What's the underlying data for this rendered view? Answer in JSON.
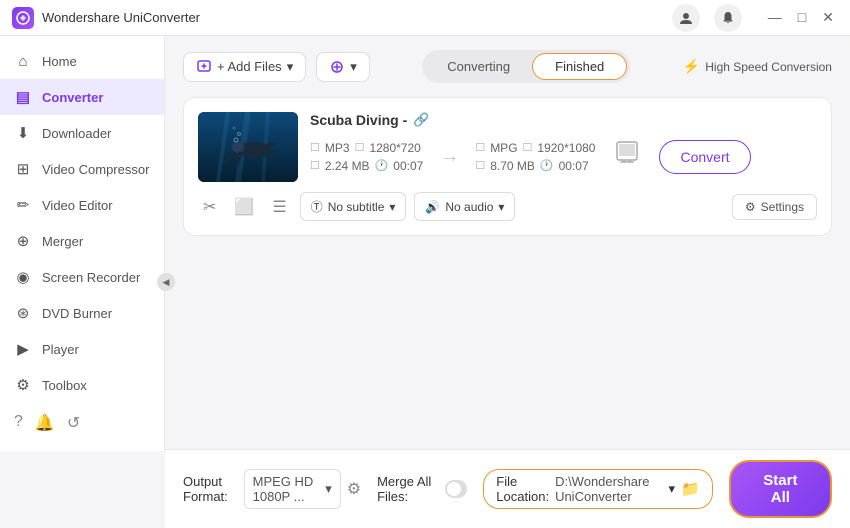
{
  "titleBar": {
    "appName": "Wondershare UniConverter",
    "logoText": "W",
    "userIcon": "👤",
    "bellIcon": "🔔",
    "minimizeIcon": "—",
    "maximizeIcon": "□",
    "closeIcon": "✕"
  },
  "sidebar": {
    "items": [
      {
        "id": "home",
        "label": "Home",
        "icon": "⌂",
        "active": false
      },
      {
        "id": "converter",
        "label": "Converter",
        "icon": "▤",
        "active": true
      },
      {
        "id": "downloader",
        "label": "Downloader",
        "icon": "⬇",
        "active": false
      },
      {
        "id": "video-compressor",
        "label": "Video Compressor",
        "icon": "⊞",
        "active": false
      },
      {
        "id": "video-editor",
        "label": "Video Editor",
        "icon": "✏",
        "active": false
      },
      {
        "id": "merger",
        "label": "Merger",
        "icon": "⊕",
        "active": false
      },
      {
        "id": "screen-recorder",
        "label": "Screen Recorder",
        "icon": "◉",
        "active": false
      },
      {
        "id": "dvd-burner",
        "label": "DVD Burner",
        "icon": "⊛",
        "active": false
      },
      {
        "id": "player",
        "label": "Player",
        "icon": "▶",
        "active": false
      },
      {
        "id": "toolbox",
        "label": "Toolbox",
        "icon": "⚙",
        "active": false
      }
    ],
    "footer": {
      "help": "?",
      "bell": "🔔",
      "refresh": "↺"
    }
  },
  "toolbar": {
    "addFilesLabel": "+ Add Files",
    "addDropdownIcon": "▾",
    "addScreenLabel": "⊕",
    "tabs": {
      "converting": "Converting",
      "finished": "Finished"
    },
    "activeTab": "finished",
    "highSpeedLabel": "High Speed Conversion",
    "highSpeedIcon": "⚡"
  },
  "fileCard": {
    "title": "Scuba Diving -",
    "editIcon": "✏",
    "source": {
      "format": "MP3",
      "resolution": "1280*720",
      "size": "2.24 MB",
      "duration": "00:07"
    },
    "target": {
      "format": "MPG",
      "resolution": "1920*1080",
      "size": "8.70 MB",
      "duration": "00:07"
    },
    "actions": {
      "cut": "✂",
      "copy": "⬜",
      "menu": "☰"
    },
    "subtitle": "No subtitle",
    "audio": "No audio",
    "settingsLabel": "Settings",
    "convertLabel": "Convert"
  },
  "bottomBar": {
    "outputFormatLabel": "Output Format:",
    "outputFormatValue": "MPEG HD 1080P ...",
    "mergeFilesLabel": "Merge All Files:",
    "fileLocationLabel": "File Location:",
    "fileLocationPath": "D:\\Wondershare UniConverter",
    "startAllLabel": "Start All"
  }
}
